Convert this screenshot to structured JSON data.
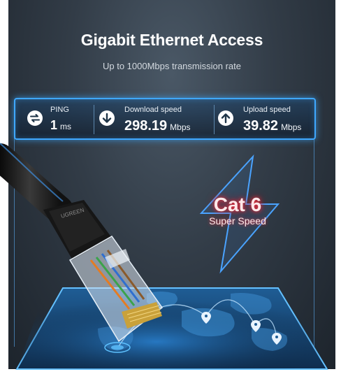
{
  "header": {
    "title": "Gigabit Ethernet Access",
    "subtitle": "Up to 1000Mbps transmission rate"
  },
  "stats": {
    "ping": {
      "label": "PING",
      "value": "1",
      "unit": "ms",
      "icon": "ping-arrows-icon"
    },
    "download": {
      "label": "Download speed",
      "value": "298.19",
      "unit": "Mbps",
      "icon": "download-arrow-icon"
    },
    "upload": {
      "label": "Upload speed",
      "value": "39.82",
      "unit": "Mbps",
      "icon": "upload-arrow-icon"
    }
  },
  "badge": {
    "title": "Cat 6",
    "subtitle": "Super Speed"
  },
  "cable": {
    "brand_text": "UGREEN"
  },
  "colors": {
    "accent_blue": "#3fa8ff",
    "panel_dark": "#2b343e",
    "badge_red": "#ff3040"
  }
}
